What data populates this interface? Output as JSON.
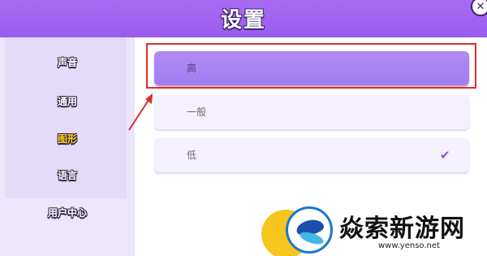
{
  "header": {
    "title": "设置",
    "close_icon": "close-icon"
  },
  "sidebar": {
    "items": [
      {
        "label": "声音",
        "active": false
      },
      {
        "label": "通用",
        "active": false
      },
      {
        "label": "图形",
        "active": true
      },
      {
        "label": "语言",
        "active": false
      },
      {
        "label": "用户中心",
        "active": false
      }
    ]
  },
  "graphics_options": [
    {
      "label": "高",
      "selected": true
    },
    {
      "label": "一般",
      "selected": false
    },
    {
      "label": "低",
      "selected": false,
      "checked": true
    }
  ],
  "annotation": {
    "highlight_color": "#e02c2c",
    "target": "graphics_options.0"
  },
  "watermark": {
    "name": "焱索新游网",
    "url": "www.yenso.net"
  },
  "colors": {
    "header": "#9a5cef",
    "sidebar_bg": "#ece5fb",
    "selected_option": "#a27eef",
    "active_tab_text": "#ffd21f",
    "check": "#8a54d8"
  }
}
